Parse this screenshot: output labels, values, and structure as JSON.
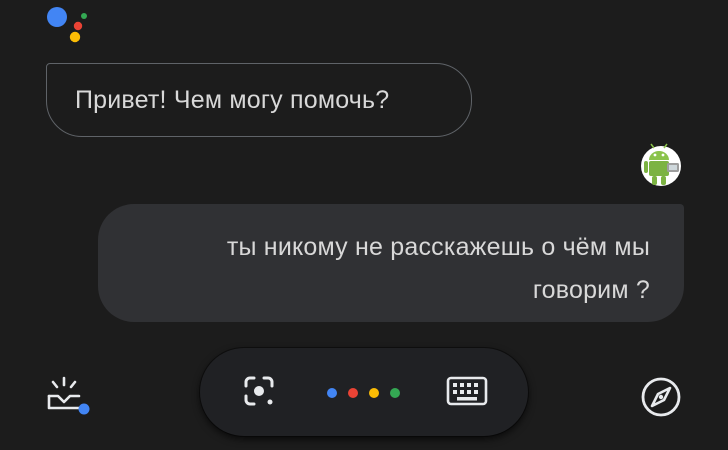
{
  "conversation": {
    "assistant_message": "Привет! Чем могу помочь?",
    "user_message_line1": "ты никому не расскажешь о чём мы",
    "user_message_line2": "говорим ?"
  },
  "icons": {
    "assistant_logo": "google-assistant-logo",
    "user_avatar": "android-robot-avatar",
    "updates": "snapshot-tray-icon",
    "lens": "google-lens-icon",
    "mic": "assistant-mic-dots",
    "keyboard": "keyboard-icon",
    "explore": "compass-icon"
  },
  "colors": {
    "background": "#1c1c1c",
    "assistant_bubble_border": "#5f6368",
    "user_bubble": "#303134",
    "pill": "#202124",
    "google_blue": "#4285f4",
    "google_red": "#ea4335",
    "google_yellow": "#fbbc05",
    "google_green": "#34a853"
  }
}
